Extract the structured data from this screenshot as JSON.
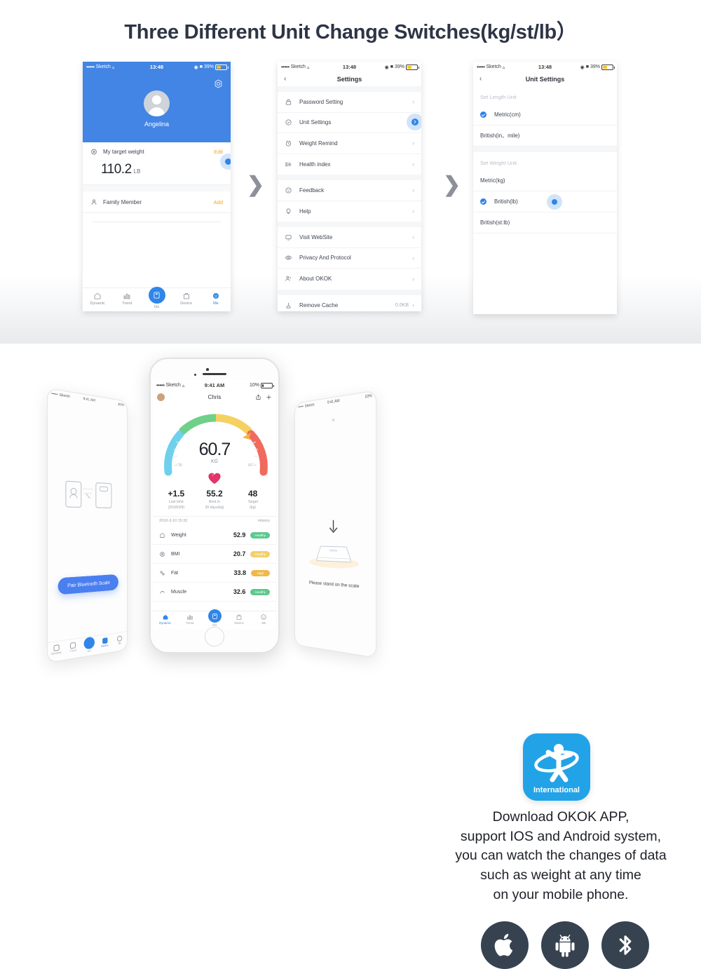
{
  "page": {
    "title": "Three Different Unit Change Switches(kg/st/lb）"
  },
  "status_bar": {
    "carrier": "Sketch",
    "dots": "•••••",
    "time_top": "13:48",
    "battery_top": "39%",
    "time_main": "9:41 AM",
    "battery_main": "10%"
  },
  "phone_a": {
    "name": "profile-me",
    "user_name": "Angelina",
    "gear_icon": "gear-icon",
    "target_label": "My target weight",
    "target_action": "Edit",
    "target_value": "110.2",
    "target_unit": "LB",
    "family_label": "Family Member",
    "family_action": "Add",
    "tabs": [
      {
        "label": "Dynamic",
        "icon": "home-icon"
      },
      {
        "label": "Trend",
        "icon": "chart-icon"
      },
      {
        "label": "Go",
        "icon": "scale-icon"
      },
      {
        "label": "Device",
        "icon": "device-icon"
      },
      {
        "label": "Me",
        "icon": "face-icon"
      }
    ]
  },
  "phone_b": {
    "title": "Settings",
    "back_icon": "chevron-left-icon",
    "group1": [
      {
        "label": "Password Setting",
        "icon": "lock-icon"
      },
      {
        "label": "Unit Settings",
        "icon": "check-circle-icon"
      },
      {
        "label": "Weight Remind",
        "icon": "alarm-icon"
      },
      {
        "label": "Health index",
        "icon": "list-icon"
      }
    ],
    "group2": [
      {
        "label": "Feedback",
        "icon": "smile-icon"
      },
      {
        "label": "Help",
        "icon": "bulb-icon"
      }
    ],
    "group3": [
      {
        "label": "Visit WebSite",
        "icon": "monitor-icon"
      },
      {
        "label": "Privacy And Protocol",
        "icon": "eye-icon"
      },
      {
        "label": "About OKOK",
        "icon": "people-icon"
      }
    ],
    "group4": [
      {
        "label": "Remove Cache",
        "icon": "broom-icon",
        "value": "0.0KB"
      }
    ],
    "chevron": "›"
  },
  "phone_c": {
    "title": "Unit Settings",
    "back_icon": "chevron-left-icon",
    "length_group_title": "Set Length Unit",
    "length_options": [
      {
        "label": "Metric(cm)",
        "selected": true
      },
      {
        "label": "British(in、mile)",
        "selected": false
      }
    ],
    "weight_group_title": "Set Weight Unit",
    "weight_options": [
      {
        "label": "Metric(kg)",
        "selected": false
      },
      {
        "label": "British(lb)",
        "selected": true
      },
      {
        "label": "British(st:lb)",
        "selected": false
      }
    ]
  },
  "main_phone": {
    "user_name": "Chris",
    "share_icon": "share-icon",
    "add_icon": "plus-icon",
    "gauge": {
      "value": "60.7",
      "unit": "KG",
      "tick_low": "30",
      "tick_high": "60",
      "colors": {
        "blue": "#6fd0ec",
        "green": "#6fd08a",
        "yellow": "#f5d161",
        "red": "#f06a5e"
      }
    },
    "stats": [
      {
        "value": "+1.5",
        "caption": "Last time\n(2018/3/9)"
      },
      {
        "value": "55.2",
        "caption": "Best in\n30 days(kg)"
      },
      {
        "value": "48",
        "caption": "Target\n(kg)"
      }
    ],
    "history_date": "2018-3-10 15:32",
    "history_link": "History",
    "history_rows": [
      {
        "name": "Weight",
        "value": "52.9",
        "badge": "Healthy",
        "badge_color": "#5bc98d",
        "icon": "weight-icon"
      },
      {
        "name": "BMI",
        "value": "20.7",
        "badge": "Healthy",
        "badge_color": "#f2cf6b",
        "icon": "bmi-icon"
      },
      {
        "name": "Fat",
        "value": "33.8",
        "badge": "High",
        "badge_color": "#eeb94a",
        "icon": "fat-icon"
      },
      {
        "name": "Muscle",
        "value": "32.6",
        "badge": "Healthy",
        "badge_color": "#5bc98d",
        "icon": "muscle-icon"
      }
    ],
    "tabs": [
      {
        "label": "Dynamic"
      },
      {
        "label": "Trend"
      },
      {
        "label": "GO"
      },
      {
        "label": "Device"
      },
      {
        "label": "Me"
      }
    ]
  },
  "tilt_left": {
    "pair_button": "Pair Bluetooth Scale",
    "tabs": [
      {
        "label": "Dynamic"
      },
      {
        "label": "Trend"
      },
      {
        "label": "GO"
      },
      {
        "label": "Device"
      },
      {
        "label": "Me"
      }
    ]
  },
  "tilt_right": {
    "close_icon": "close-icon",
    "arrow_icon": "arrow-down-icon",
    "caption": "Please stand on the scale"
  },
  "promo": {
    "logo_label": "International",
    "line1": "Download OKOK APP,",
    "line2": "support IOS and Android system,",
    "line3": "you can watch the changes of data",
    "line4": "such as weight at any time",
    "line5": "on your mobile phone.",
    "os_icons": [
      {
        "name": "apple-icon"
      },
      {
        "name": "android-icon"
      },
      {
        "name": "bluetooth-icon"
      }
    ]
  },
  "arrows": {
    "glyph": "❯"
  },
  "colors": {
    "brand_blue": "#2f86e8",
    "hero_blue": "#4285e4",
    "logo_blue": "#22a3e8",
    "accent_orange": "#f5a623",
    "title_dark": "#2d3545"
  }
}
